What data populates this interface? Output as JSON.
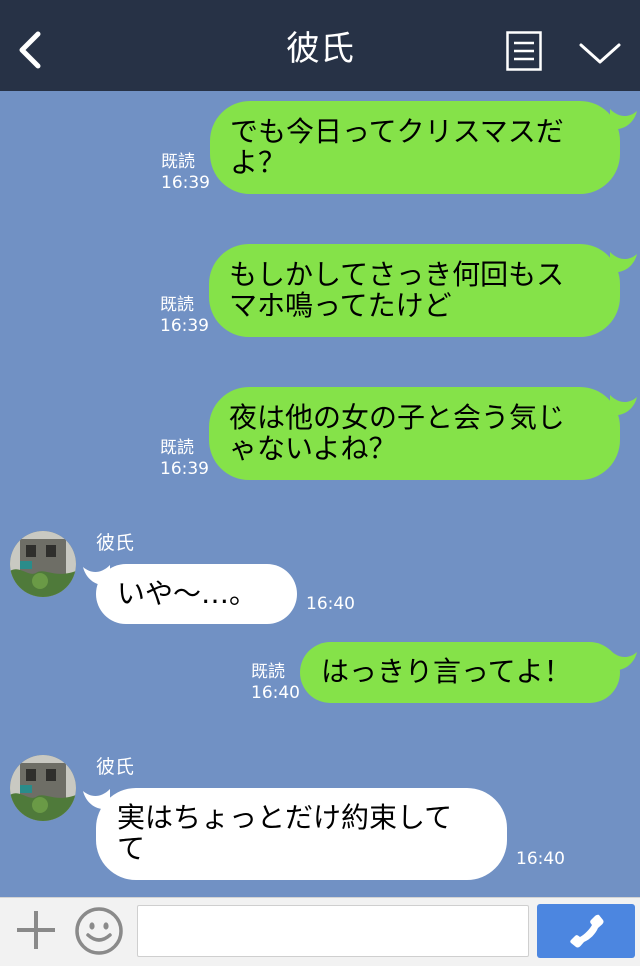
{
  "header": {
    "title": "彼氏",
    "back_icon": "chevron-left-icon",
    "menu_icon": "note-list-icon",
    "collapse_icon": "chevron-down-icon",
    "bg_color": "#273246"
  },
  "chat": {
    "bg_color": "#7191c4",
    "mine_bubble_color": "#85e249",
    "theirs_bubble_color": "#ffffff",
    "messages": [
      {
        "from": "me",
        "lines": [
          "でも今日ってクリスマスだ",
          "よ？"
        ],
        "read": "既読",
        "time": "16:39"
      },
      {
        "from": "me",
        "lines": [
          "もしかしてさっき何回もス",
          "マホ鳴ってたけど"
        ],
        "read": "既読",
        "time": "16:39"
      },
      {
        "from": "me",
        "lines": [
          "夜は他の女の子と会う気じ",
          "ゃないよね？"
        ],
        "read": "既読",
        "time": "16:39"
      },
      {
        "from": "them",
        "sender": "彼氏",
        "lines": [
          "いや〜…。"
        ],
        "time": "16:40"
      },
      {
        "from": "me",
        "lines": [
          "はっきり言ってよ！"
        ],
        "read": "既読",
        "time": "16:40"
      },
      {
        "from": "them",
        "sender": "彼氏",
        "lines": [
          "実はちょっとだけ約束して",
          "て"
        ],
        "time": "16:40"
      }
    ]
  },
  "footer": {
    "plus_icon": "plus-icon",
    "emoji_icon": "smiley-icon",
    "input_value": "",
    "input_placeholder": "",
    "call_icon": "phone-icon",
    "call_color": "#4c86e0"
  }
}
